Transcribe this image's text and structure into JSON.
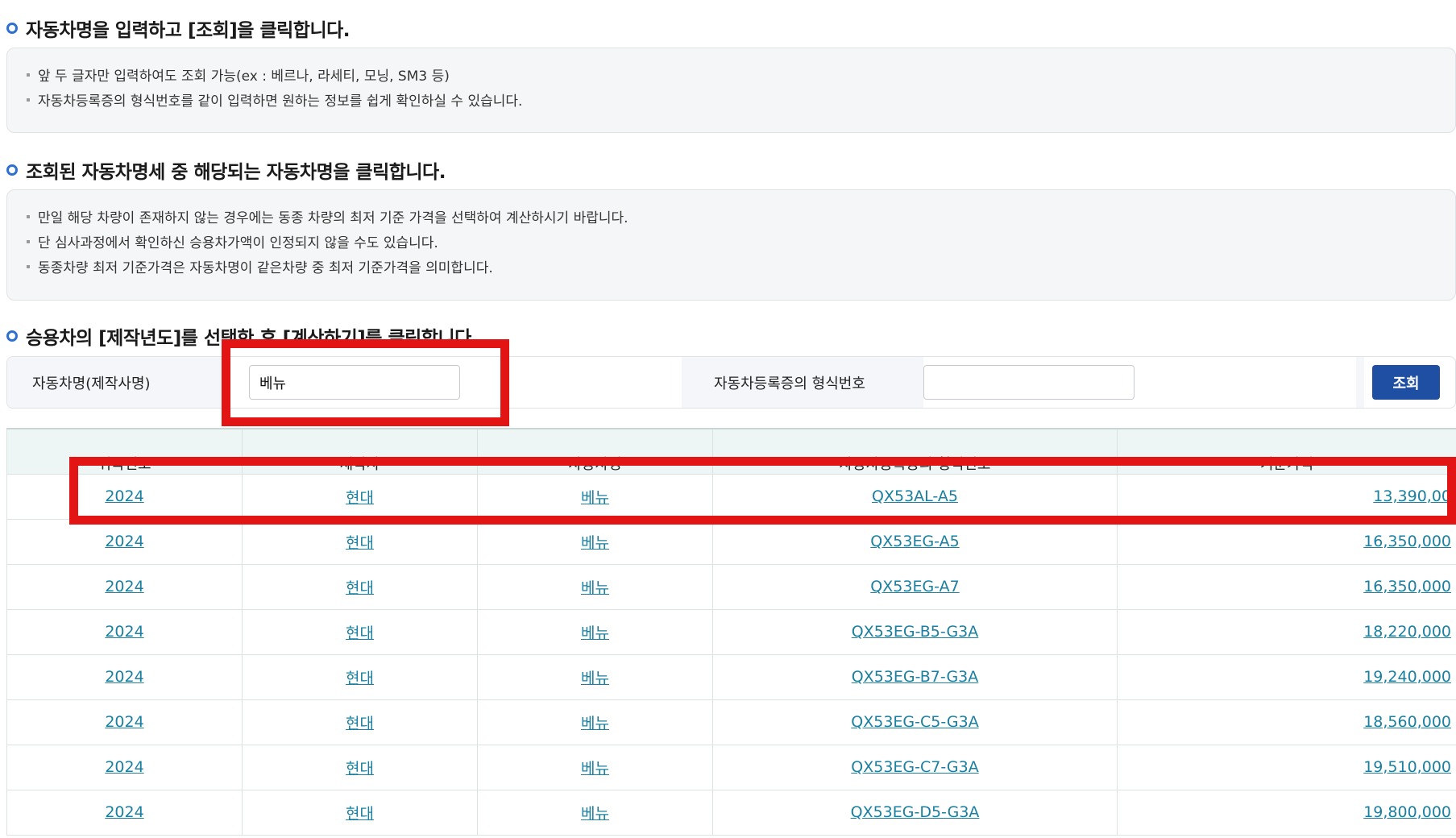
{
  "step1": {
    "title": "자동차명을 입력하고 [조회]을 클릭합니다.",
    "notes": [
      "앞 두 글자만 입력하여도 조회 가능(ex : 베르나, 라세티, 모닝, SM3 등)",
      "자동차등록증의 형식번호를 같이 입력하면 원하는 정보를 쉽게 확인하실 수 있습니다."
    ]
  },
  "step2": {
    "title": "조회된 자동차명세 중 해당되는 자동차명을 클릭합니다.",
    "notes": [
      "만일 해당 차량이 존재하지 않는 경우에는 동종 차량의 최저 기준 가격을 선택하여 계산하시기 바랍니다.",
      "단 심사과정에서 확인하신 승용차가액이 인정되지 않을 수도 있습니다.",
      "동종차량 최저 기준가격은 자동차명이 같은차량 중  최저 기준가격을 의미합니다."
    ]
  },
  "step3": {
    "title": "승용차의 [제작년도]를 선택한 후 [계산하기]를 클릭합니다."
  },
  "search": {
    "car_name_label": "자동차명(제작사명)",
    "car_name_value": "베뉴",
    "type_no_label": "자동차등록증의 형식번호",
    "type_no_value": "",
    "search_button": "조회"
  },
  "table": {
    "headers": [
      "귀속연도",
      "제작사",
      "자동차명",
      "자동차등록증의 형식번호",
      "기준가격"
    ],
    "rows": [
      [
        "2024",
        "현대",
        "베뉴",
        "QX53AL-A5",
        "13,390,00"
      ],
      [
        "2024",
        "현대",
        "베뉴",
        "QX53EG-A5",
        "16,350,000"
      ],
      [
        "2024",
        "현대",
        "베뉴",
        "QX53EG-A7",
        "16,350,000"
      ],
      [
        "2024",
        "현대",
        "베뉴",
        "QX53EG-B5-G3A",
        "18,220,000"
      ],
      [
        "2024",
        "현대",
        "베뉴",
        "QX53EG-B7-G3A",
        "19,240,000"
      ],
      [
        "2024",
        "현대",
        "베뉴",
        "QX53EG-C5-G3A",
        "18,560,000"
      ],
      [
        "2024",
        "현대",
        "베뉴",
        "QX53EG-C7-G3A",
        "19,510,000"
      ],
      [
        "2024",
        "현대",
        "베뉴",
        "QX53EG-D5-G3A",
        "19,800,000"
      ]
    ]
  },
  "colors": {
    "accent": "#2f6fd1",
    "button": "#1e4fa3",
    "link": "#1a7fa0",
    "highlight": "#e31414",
    "table_header_bg": "#eef6f5"
  }
}
